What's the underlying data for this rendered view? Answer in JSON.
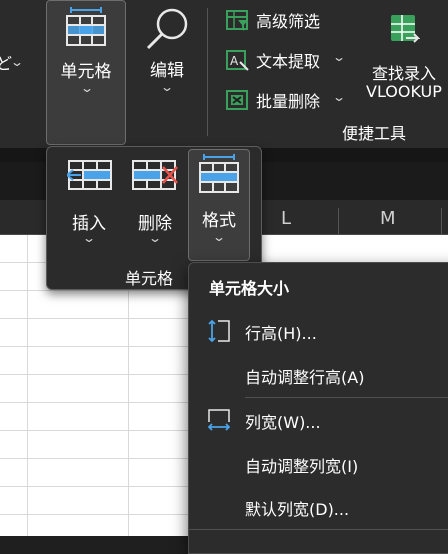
{
  "ribbon": {
    "partial_left_label": "ど",
    "cell_btn": {
      "label": "单元格"
    },
    "edit_btn": {
      "label": "编辑"
    },
    "advanced_filter": "高级筛选",
    "text_extract": "文本提取",
    "bulk_delete": "批量删除",
    "vlookup_line1": "查找录入",
    "vlookup_line2": "VLOOKUP",
    "group_quick_tools": "便捷工具"
  },
  "flyout": {
    "insert": "插入",
    "delete": "删除",
    "format": "格式",
    "group_label": "单元格"
  },
  "columns": {
    "l": "L",
    "m": "M"
  },
  "menu": {
    "header": "单元格大小",
    "items": [
      {
        "label": "行高(H)..."
      },
      {
        "label": "自动调整行高(A)"
      },
      {
        "label": "列宽(W)..."
      },
      {
        "label": "自动调整列宽(I)"
      },
      {
        "label": "默认列宽(D)..."
      }
    ]
  },
  "colors": {
    "accent_blue": "#4aa3e8",
    "green": "#3aa15c",
    "red": "#e5534b"
  }
}
